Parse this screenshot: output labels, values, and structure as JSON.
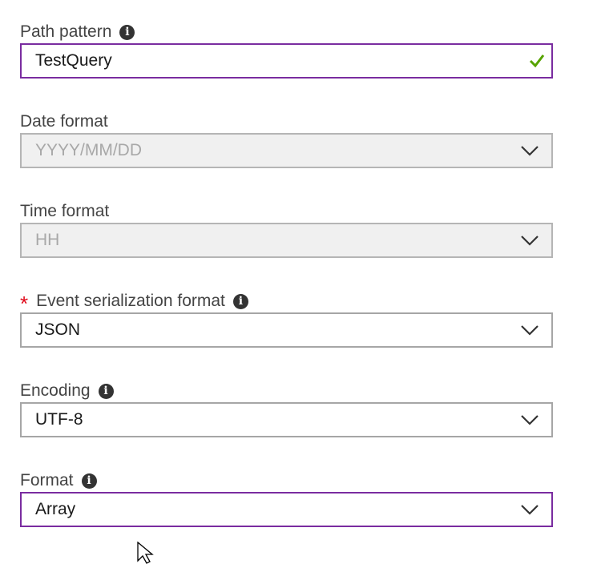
{
  "fields": {
    "path_pattern": {
      "label": "Path pattern",
      "value": "TestQuery",
      "valid": true
    },
    "date_format": {
      "label": "Date format",
      "value": "YYYY/MM/DD",
      "disabled": true
    },
    "time_format": {
      "label": "Time format",
      "value": "HH",
      "disabled": true
    },
    "event_serialization": {
      "label": "Event serialization format",
      "required_marker": "*",
      "value": "JSON"
    },
    "encoding": {
      "label": "Encoding",
      "value": "UTF-8"
    },
    "format": {
      "label": "Format",
      "value": "Array"
    }
  },
  "icons": {
    "info": "info-icon",
    "dropdown": "chevron-down-icon",
    "valid": "checkmark-icon",
    "info_glyph": "i"
  },
  "colors": {
    "focus_border": "#7a2ca0",
    "valid_check": "#57a300",
    "required": "#e00b1c",
    "disabled_bg": "#f0f0f0"
  }
}
